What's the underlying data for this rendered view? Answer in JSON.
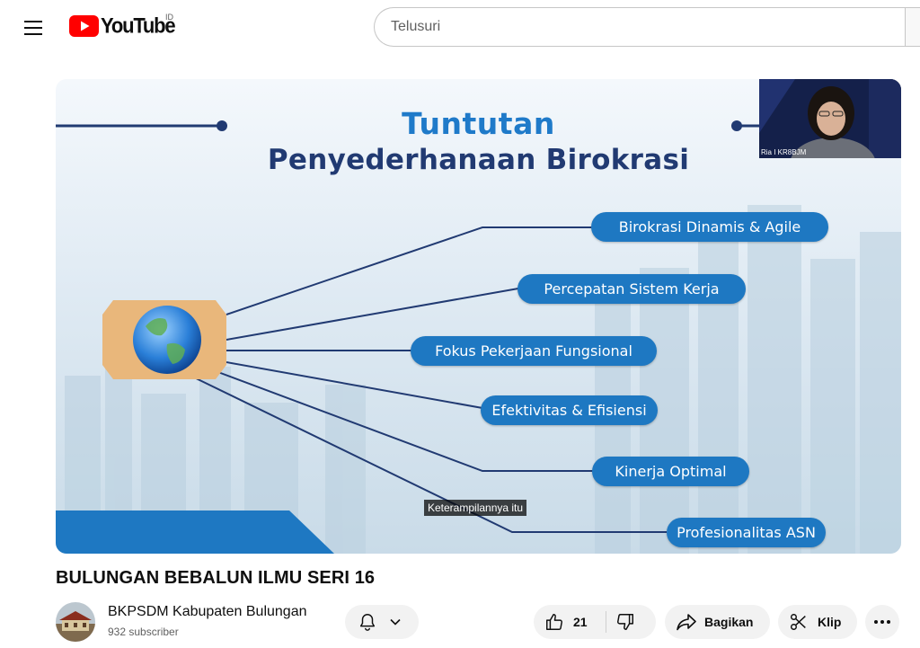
{
  "header": {
    "logo_text": "YouTube",
    "country_code": "ID",
    "search_placeholder": "Telusuri"
  },
  "slide": {
    "title_line1": "Tuntutan",
    "title_line2": "Penyederhanaan Birokrasi",
    "items": [
      "Birokrasi Dinamis & Agile",
      "Percepatan Sistem Kerja",
      "Fokus Pekerjaan Fungsional",
      "Efektivitas & Efisiensi",
      "Kinerja Optimal",
      "Profesionalitas ASN"
    ],
    "caption": "Keterampilannya itu",
    "pip_name": "Ria I KR8BJM",
    "colors": {
      "pill": "#1e78c2",
      "title_blue": "#1f7ac9",
      "title_navy": "#213a72"
    }
  },
  "video": {
    "title": "BULUNGAN BEBALUN ILMU SERI 16"
  },
  "channel": {
    "name": "BKPSDM Kabupaten Bulungan",
    "subscribers": "932 subscriber"
  },
  "actions": {
    "likes": "21",
    "share_label": "Bagikan",
    "clip_label": "Klip"
  }
}
